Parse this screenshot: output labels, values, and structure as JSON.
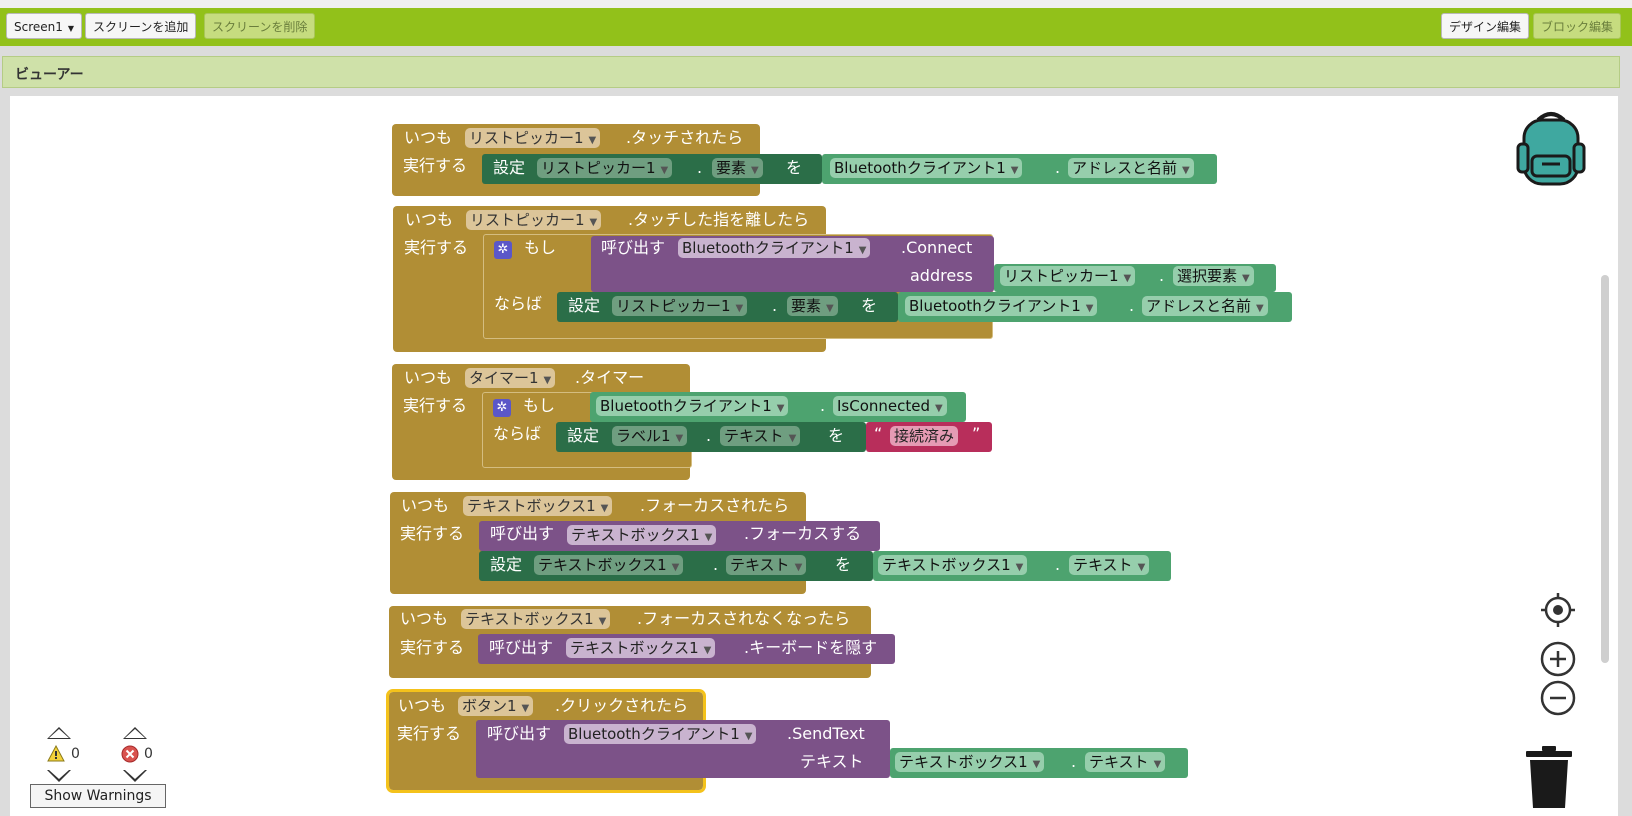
{
  "toolbar": {
    "screen_select": "Screen1",
    "add_screen": "スクリーンを追加",
    "remove_screen": "スクリーンを削除",
    "design_edit": "デザイン編集",
    "block_edit": "ブロック編集"
  },
  "viewer": {
    "title": "ビューアー"
  },
  "kw": {
    "itsumo": "いつも",
    "jikkou": "実行する",
    "settei": "設定",
    "wo": "を",
    "dot": ".",
    "yobidasu": "呼び出す",
    "moshi": "もし",
    "naraba": "ならば",
    "quote_open": "“",
    "quote_close": "”"
  },
  "blocks": {
    "b1": {
      "component": "リストピッカー1",
      "event": ".タッチされたら",
      "set_comp": "リストピッカー1",
      "set_prop": "要素",
      "get_comp": "Bluetoothクライアント1",
      "get_prop": "アドレスと名前"
    },
    "b2": {
      "component": "リストピッカー1",
      "event": ".タッチした指を離したら",
      "call_comp": "Bluetoothクライアント1",
      "method": ".Connect",
      "param": "address",
      "arg_comp": "リストピッカー1",
      "arg_prop": "選択要素",
      "set_comp": "リストピッカー1",
      "set_prop": "要素",
      "get_comp": "Bluetoothクライアント1",
      "get_prop": "アドレスと名前"
    },
    "b3": {
      "component": "タイマー1",
      "event": ".タイマー",
      "cond_comp": "Bluetoothクライアント1",
      "cond_prop": "IsConnected",
      "set_comp": "ラベル1",
      "set_prop": "テキスト",
      "string": "接続済み"
    },
    "b4": {
      "component": "テキストボックス1",
      "event": ".フォーカスされたら",
      "call_comp": "テキストボックス1",
      "method": ".フォーカスする",
      "set_comp": "テキストボックス1",
      "set_prop": "テキスト",
      "get_comp": "テキストボックス1",
      "get_prop": "テキスト"
    },
    "b5": {
      "component": "テキストボックス1",
      "event": ".フォーカスされなくなったら",
      "call_comp": "テキストボックス1",
      "method": ".キーボードを隠す"
    },
    "b6": {
      "component": "ボタン1",
      "event": ".クリックされたら",
      "call_comp": "Bluetoothクライアント1",
      "method": ".SendText",
      "param": "テキスト",
      "arg_comp": "テキストボックス1",
      "arg_prop": "テキスト"
    }
  },
  "warnings": {
    "warning_count": "0",
    "error_count": "0",
    "show_warnings": "Show Warnings"
  },
  "colors": {
    "toolbar": "#92c11a",
    "event": "#b18e35",
    "setter": "#2b6e48",
    "getter": "#4da36f",
    "call": "#7c5288",
    "string": "#b82e5b",
    "selected_outline": "#f4c21b"
  },
  "icons": [
    "warning-icon",
    "error-icon",
    "backpack-icon",
    "center-icon",
    "zoom-in-icon",
    "zoom-out-icon",
    "trash-icon",
    "gear-icon"
  ]
}
